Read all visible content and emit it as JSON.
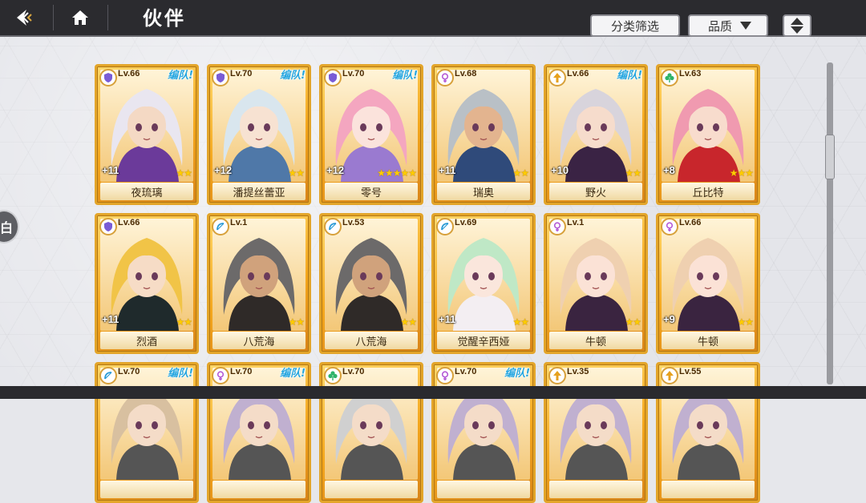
{
  "header": {
    "title": "伙伴",
    "filter_label": "分类筛选",
    "quality_label": "品质",
    "side_tab_label": "白"
  },
  "cards": [
    {
      "level": "Lv.66",
      "team": "编队!",
      "plus": "+11",
      "stars": "★★",
      "name": "夜琉璃",
      "class_icon": "shield-icon",
      "class_color": "#7a5cd6",
      "hair": "#e9e6f0",
      "skin": "#f4d9c4",
      "outfit": "#6b3a9a"
    },
    {
      "level": "Lv.70",
      "team": "编队!",
      "plus": "+12",
      "stars": "★★",
      "name": "潘提丝蕾亚",
      "class_icon": "shield-icon",
      "class_color": "#7a5cd6",
      "hair": "#d9e6ee",
      "skin": "#f7e2d2",
      "outfit": "#4f78a8"
    },
    {
      "level": "Lv.70",
      "team": "编队!",
      "plus": "+12",
      "stars": "★★★★★",
      "name": "零号",
      "class_icon": "shield-icon",
      "class_color": "#7a5cd6",
      "hair": "#f4a6c0",
      "skin": "#fbe3dc",
      "outfit": "#9a7ad0"
    },
    {
      "level": "Lv.68",
      "team": "",
      "plus": "+11",
      "stars": "★★",
      "name": "瑞奥",
      "class_icon": "venus-icon",
      "class_color": "#b45ad6",
      "hair": "#b9c0c6",
      "skin": "#e3b48f",
      "outfit": "#2f4a7a"
    },
    {
      "level": "Lv.66",
      "team": "编队!",
      "plus": "+10",
      "stars": "★★",
      "name": "野火",
      "class_icon": "arrow-up-icon",
      "class_color": "#e6a11e",
      "hair": "#d8d4dc",
      "skin": "#f6dccc",
      "outfit": "#3a2344"
    },
    {
      "level": "Lv.63",
      "team": "",
      "plus": "+8",
      "stars": "★★★",
      "name": "丘比特",
      "class_icon": "clover-icon",
      "class_color": "#2fb36a",
      "hair": "#f09ab0",
      "skin": "#f8dccd",
      "outfit": "#c8262c"
    },
    {
      "level": "Lv.66",
      "team": "",
      "plus": "+11",
      "stars": "★★",
      "name": "烈酒",
      "class_icon": "shield-icon",
      "class_color": "#7a5cd6",
      "hair": "#f1c447",
      "skin": "#f6dcc6",
      "outfit": "#1f2a2c"
    },
    {
      "level": "Lv.1",
      "team": "",
      "plus": "",
      "stars": "★★",
      "name": "八荒海",
      "class_icon": "bow-icon",
      "class_color": "#2a9ad6",
      "hair": "#6c6a6a",
      "skin": "#d0a27c",
      "outfit": "#2f2a28"
    },
    {
      "level": "Lv.53",
      "team": "",
      "plus": "",
      "stars": "★★",
      "name": "八荒海",
      "class_icon": "bow-icon",
      "class_color": "#2a9ad6",
      "hair": "#6c6a6a",
      "skin": "#d0a27c",
      "outfit": "#2f2a28"
    },
    {
      "level": "Lv.69",
      "team": "",
      "plus": "+11",
      "stars": "★★",
      "name": "觉醒辛西娅",
      "class_icon": "bow-icon",
      "class_color": "#2a9ad6",
      "hair": "#bfe8c6",
      "skin": "#fae6dc",
      "outfit": "#f3eef2"
    },
    {
      "level": "Lv.1",
      "team": "",
      "plus": "",
      "stars": "★★",
      "name": "牛顿",
      "class_icon": "venus-icon",
      "class_color": "#b45ad6",
      "hair": "#efd0b0",
      "skin": "#fbe2d6",
      "outfit": "#3a2440"
    },
    {
      "level": "Lv.66",
      "team": "",
      "plus": "+9",
      "stars": "★★",
      "name": "牛顿",
      "class_icon": "venus-icon",
      "class_color": "#b45ad6",
      "hair": "#efd0b0",
      "skin": "#fbe2d6",
      "outfit": "#3a2440"
    },
    {
      "level": "Lv.70",
      "team": "编队!",
      "plus": "",
      "stars": "",
      "name": "",
      "class_icon": "bow-icon",
      "class_color": "#2a9ad6",
      "hair": "#d8c0a0",
      "skin": "#f4dcc8",
      "outfit": "#555"
    },
    {
      "level": "Lv.70",
      "team": "编队!",
      "plus": "",
      "stars": "",
      "name": "",
      "class_icon": "venus-icon",
      "class_color": "#b45ad6",
      "hair": "#c0b0d0",
      "skin": "#f4dcc8",
      "outfit": "#555"
    },
    {
      "level": "Lv.70",
      "team": "",
      "plus": "",
      "stars": "",
      "name": "",
      "class_icon": "clover-icon",
      "class_color": "#2fb36a",
      "hair": "#d0d0d0",
      "skin": "#f4dcc8",
      "outfit": "#555"
    },
    {
      "level": "Lv.70",
      "team": "编队!",
      "plus": "",
      "stars": "",
      "name": "",
      "class_icon": "venus-icon",
      "class_color": "#b45ad6",
      "hair": "#c0b0d0",
      "skin": "#f4dcc8",
      "outfit": "#555"
    },
    {
      "level": "Lv.35",
      "team": "",
      "plus": "",
      "stars": "",
      "name": "",
      "class_icon": "arrow-up-icon",
      "class_color": "#e6a11e",
      "hair": "#c0b0d0",
      "skin": "#f4dcc8",
      "outfit": "#555"
    },
    {
      "level": "Lv.55",
      "team": "",
      "plus": "",
      "stars": "",
      "name": "",
      "class_icon": "arrow-up-icon",
      "class_color": "#e6a11e",
      "hair": "#c0b0d0",
      "skin": "#f4dcc8",
      "outfit": "#555"
    }
  ]
}
